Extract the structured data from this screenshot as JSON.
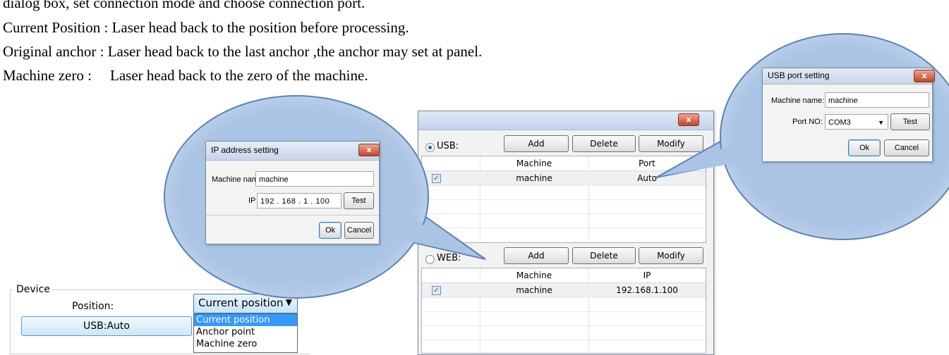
{
  "doc": {
    "line0": "dialog box, set connection mode and choose connection port.",
    "line1": "Current Position : Laser head back to the position before processing.",
    "line2": "Original anchor : Laser head back to the last anchor ,the anchor may set at panel.",
    "line3_label": "Machine zero :",
    "line3_text": "Laser head back to the zero of the machine."
  },
  "device_panel": {
    "group_label": "Device",
    "position_label": "Position:",
    "position_value": "Current position",
    "usb_button": "USB:Auto",
    "dropdown_options": [
      "Current position",
      "Anchor point",
      "Machine zero"
    ]
  },
  "ip_dialog": {
    "title": "IP address setting",
    "close": "x",
    "machine_name_label": "Machine name:",
    "machine_name_value": "machine",
    "ip_label": "IP",
    "ip_parts": [
      "192",
      "168",
      "1",
      "100"
    ],
    "test": "Test",
    "ok": "Ok",
    "cancel": "Cancel"
  },
  "main_dialog": {
    "close": "x",
    "usb_label": "USB:",
    "web_label": "WEB:",
    "add": "Add",
    "delete": "Delete",
    "modify": "Modify",
    "usb_columns": [
      "Machine",
      "Port"
    ],
    "usb_row": {
      "machine": "machine",
      "port": "Auto",
      "checked": "✓"
    },
    "web_columns": [
      "Machine",
      "IP"
    ],
    "web_row": {
      "machine": "machine",
      "ip": "192.168.1.100",
      "checked": "✓"
    }
  },
  "usb_dialog": {
    "title": "USB port setting",
    "close": "x",
    "machine_name_label": "Machine name:",
    "machine_name_value": "machine",
    "port_label": "Port NO:",
    "port_value": "COM3",
    "test": "Test",
    "ok": "Ok",
    "cancel": "Cancel"
  },
  "colors": {
    "balloon_fill": "#a9c4e4",
    "balloon_border": "#5b82b5",
    "selection": "#3399ff"
  }
}
